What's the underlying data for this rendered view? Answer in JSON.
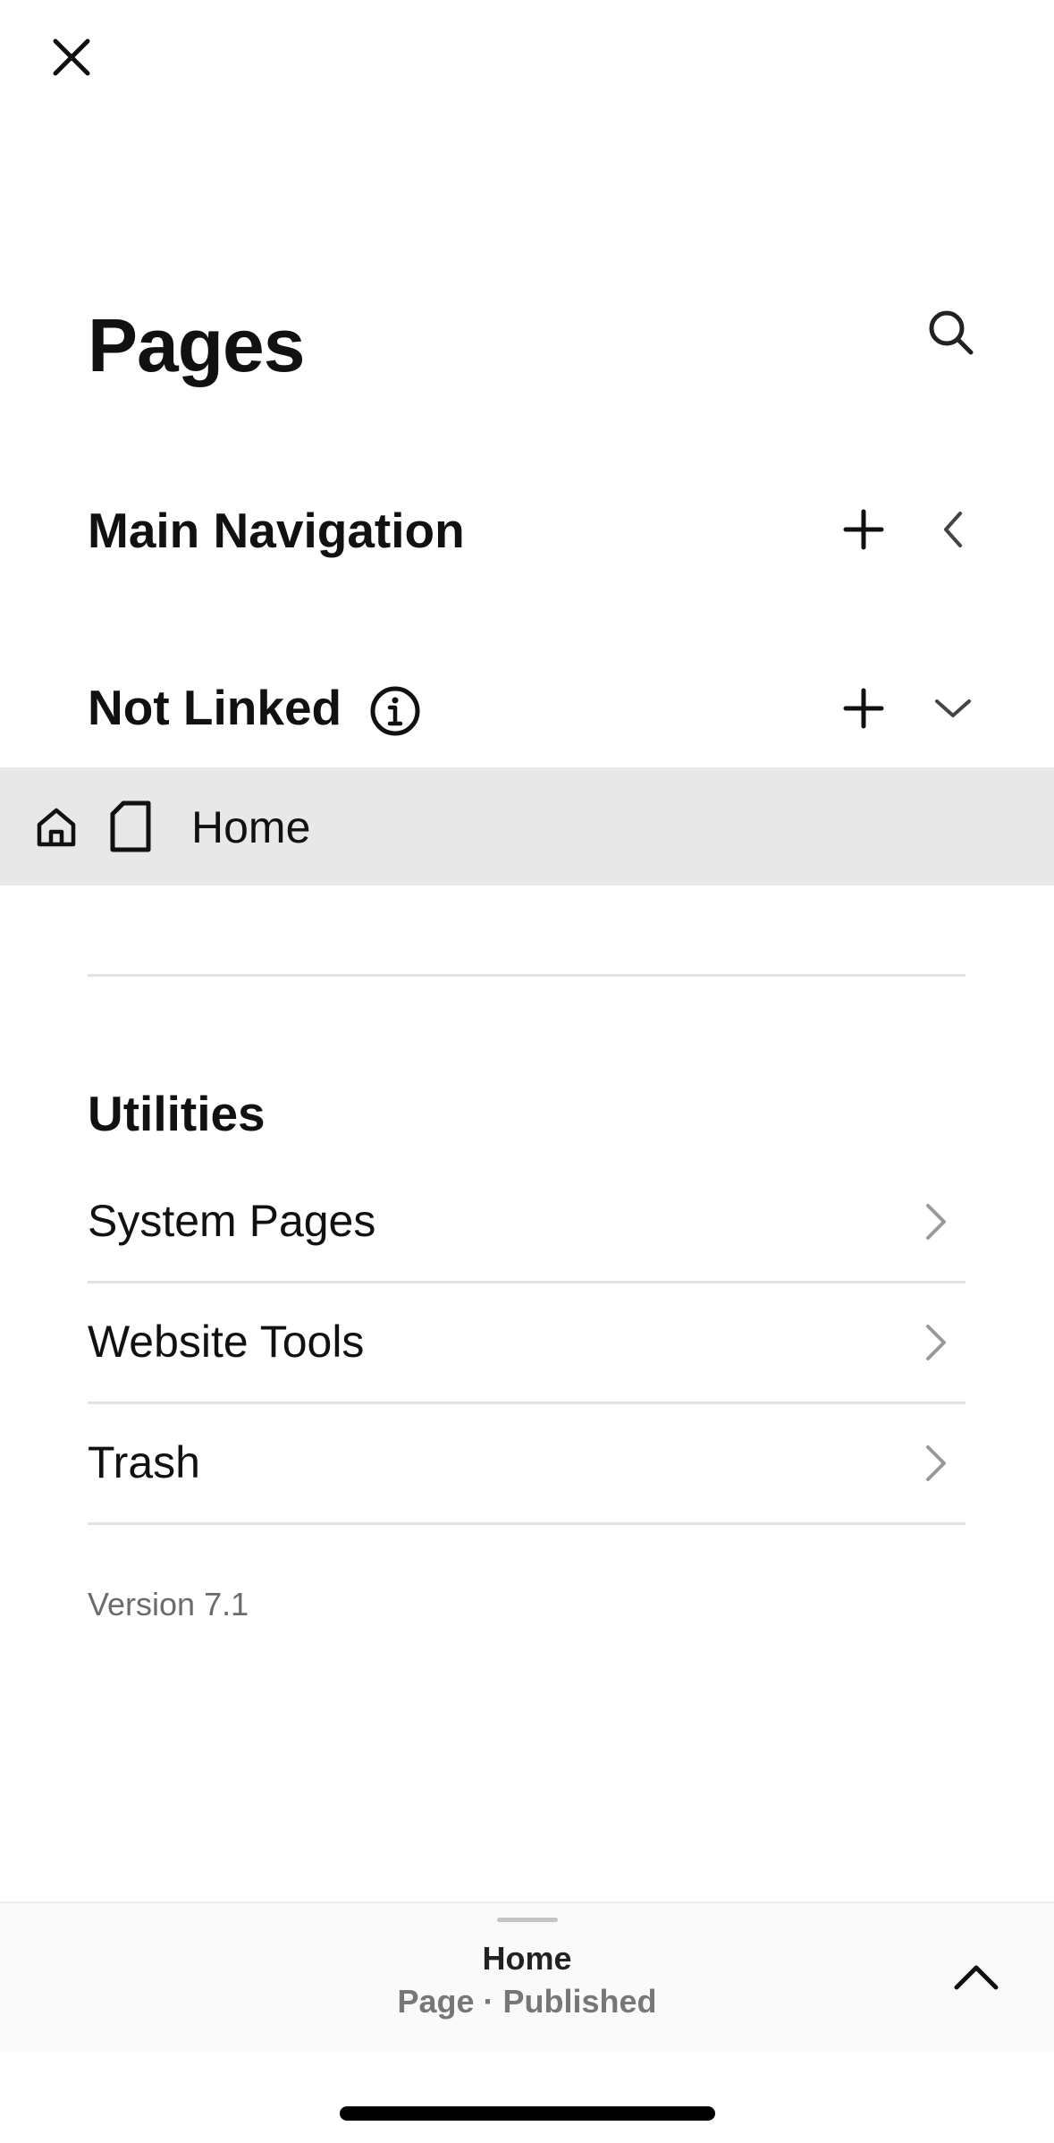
{
  "header": {
    "title": "Pages",
    "close_icon": "close-icon",
    "search_icon": "search-icon"
  },
  "sections": {
    "main_navigation": {
      "title": "Main Navigation",
      "add_icon": "plus-icon",
      "toggle_icon": "chevron-left-icon"
    },
    "not_linked": {
      "title": "Not Linked",
      "info_icon": "info-icon",
      "add_icon": "plus-icon",
      "toggle_icon": "chevron-down-icon",
      "pages": [
        {
          "label": "Home",
          "icons": [
            "home-icon",
            "page-icon"
          ],
          "selected": true
        }
      ]
    }
  },
  "utilities": {
    "title": "Utilities",
    "items": [
      {
        "label": "System Pages"
      },
      {
        "label": "Website Tools"
      },
      {
        "label": "Trash"
      }
    ]
  },
  "version": "Version 7.1",
  "bottom_panel": {
    "page_name": "Home",
    "page_status": "Page · Published",
    "expand_icon": "chevron-up-icon"
  },
  "colors": {
    "text": "#111111",
    "selected_row_bg": "#e8e8e8",
    "divider": "#e2e2e2",
    "muted_text": "#6b6b6b"
  }
}
